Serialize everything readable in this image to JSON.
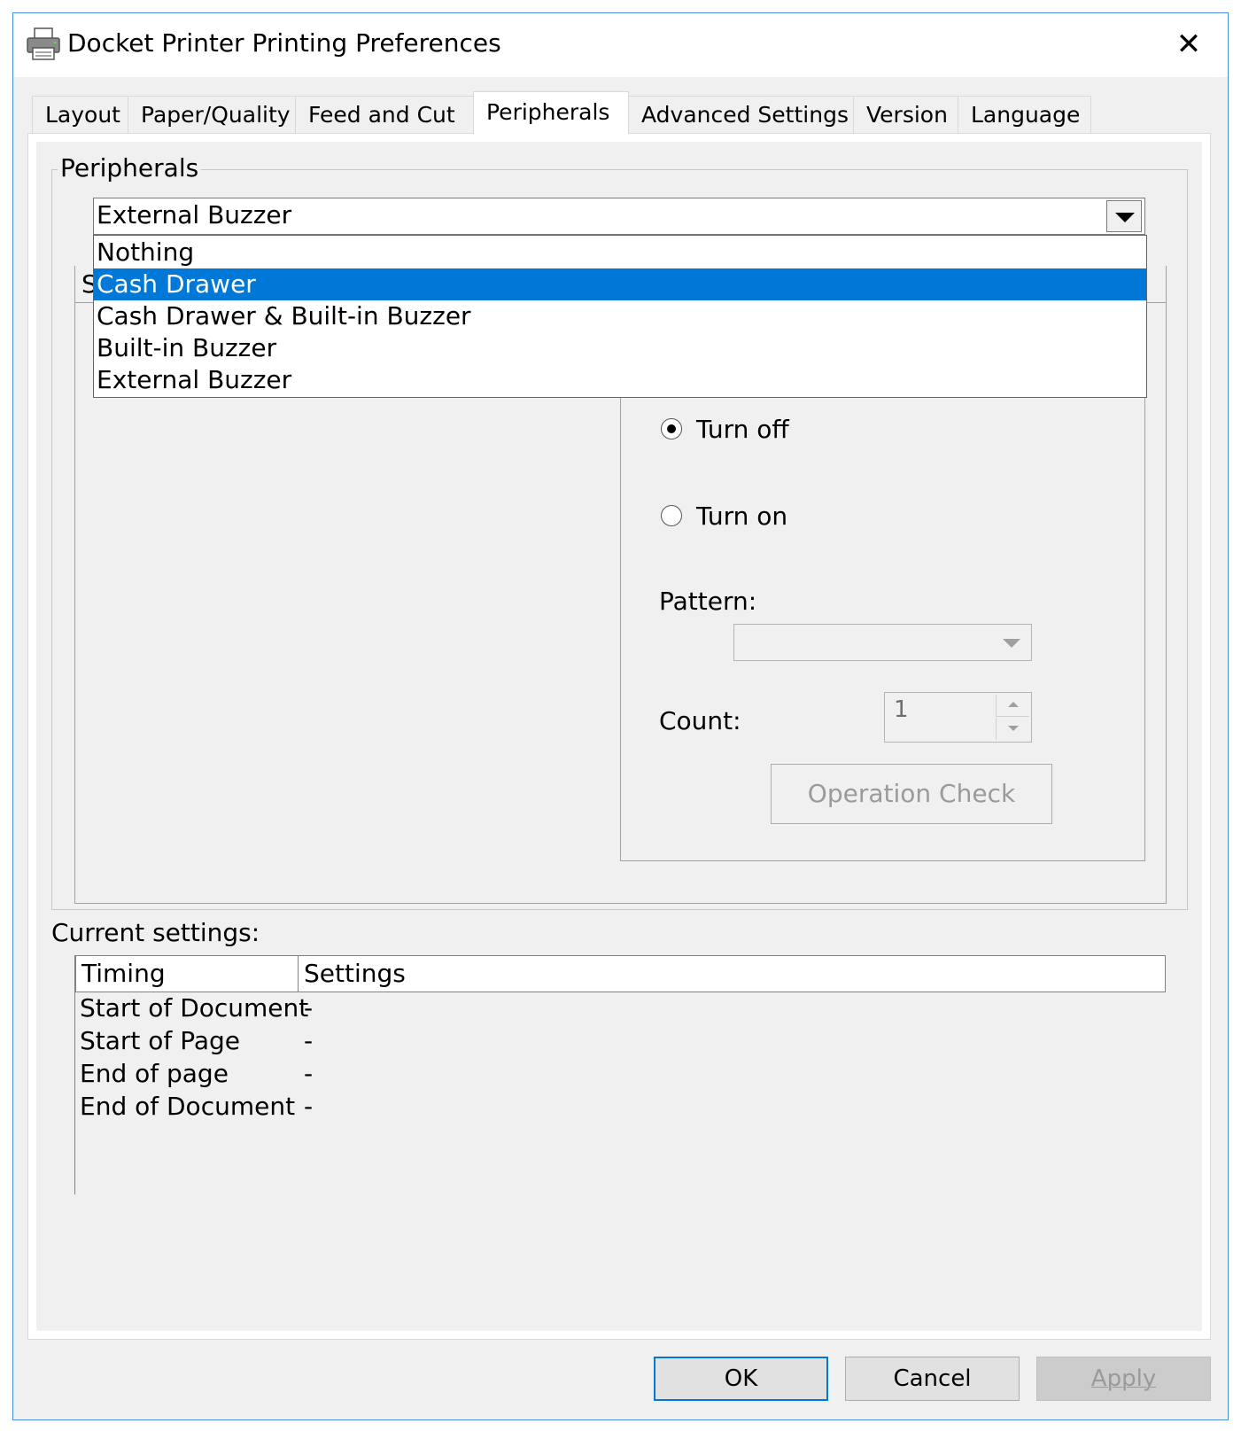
{
  "window": {
    "title": "Docket Printer Printing Preferences",
    "close_glyph": "✕"
  },
  "tabs": [
    {
      "label": "Layout"
    },
    {
      "label": "Paper/Quality"
    },
    {
      "label": "Feed and Cut"
    },
    {
      "label": "Peripherals",
      "active": true
    },
    {
      "label": "Advanced Settings"
    },
    {
      "label": "Version"
    },
    {
      "label": "Language"
    }
  ],
  "peripherals_group": {
    "label": "Peripherals",
    "device_select": {
      "value": "External Buzzer",
      "options": [
        "Nothing",
        "Cash Drawer",
        "Cash Drawer & Built-in Buzzer",
        "Built-in Buzzer",
        "External Buzzer"
      ],
      "highlighted": "Cash Drawer"
    },
    "partial_label": "S",
    "radio_turn_off": {
      "label": "Turn off",
      "checked": true
    },
    "radio_turn_on": {
      "label": "Turn on",
      "checked": false
    },
    "pattern": {
      "label": "Pattern:",
      "value": ""
    },
    "count": {
      "label": "Count:",
      "value": "1"
    },
    "operation_check_label": "Operation Check"
  },
  "current_settings": {
    "label": "Current settings:",
    "columns": [
      "Timing",
      "Settings"
    ],
    "rows": [
      {
        "timing": "Start of Document",
        "setting": "-"
      },
      {
        "timing": "Start of Page",
        "setting": "-"
      },
      {
        "timing": "End of page",
        "setting": "-"
      },
      {
        "timing": "End of Document",
        "setting": "-"
      }
    ]
  },
  "buttons": {
    "ok": "OK",
    "cancel": "Cancel",
    "apply": "Apply"
  },
  "colors": {
    "selection": "#0078d7",
    "window_border": "#4a8fd6",
    "dialog_bg": "#f0f0f0"
  }
}
